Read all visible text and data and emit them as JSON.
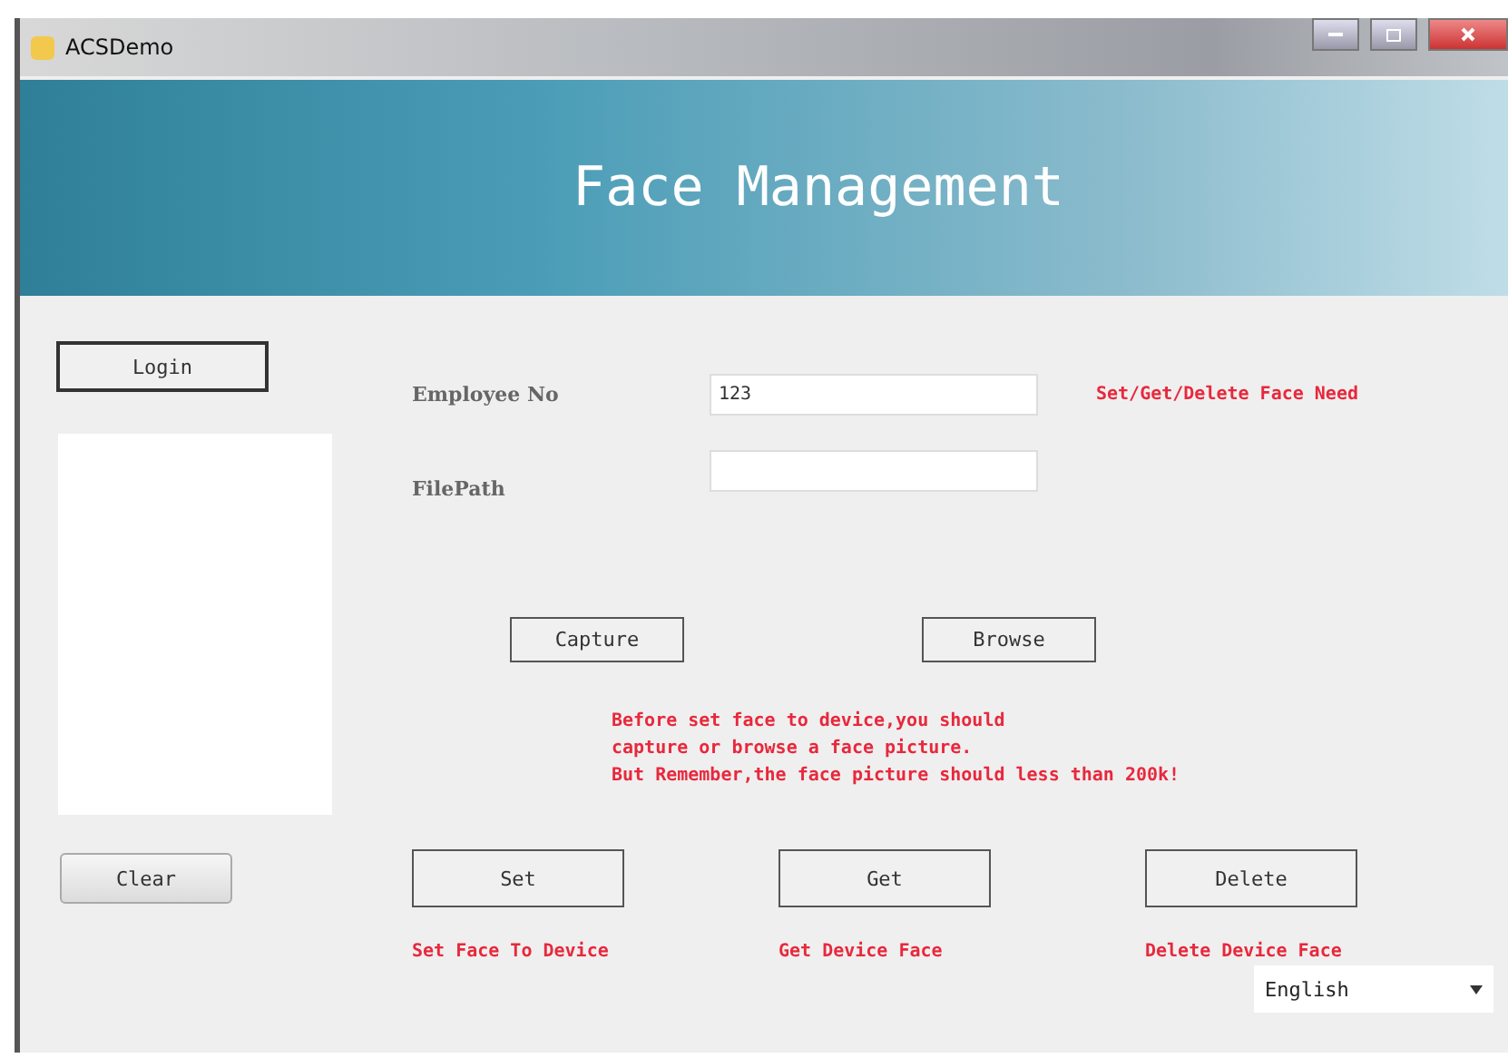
{
  "window": {
    "title": "ACSDemo"
  },
  "header": {
    "title": "Face Management"
  },
  "sidebar": {
    "login_button": "Login",
    "clear_button": "Clear"
  },
  "form": {
    "fields": [
      {
        "label": "Employee No",
        "value": "123"
      },
      {
        "label": "FilePath"
      }
    ],
    "hint": "Set/Get/Delete Face Need"
  },
  "picture_buttons": [
    "Capture",
    "Browse"
  ],
  "note": [
    "Before set face to device,you should",
    "capture or browse a face picture.",
    "But Remember,the face picture should less than 200k!"
  ],
  "actions": [
    {
      "label": "Set",
      "caption": "Set Face To Device"
    },
    {
      "label": "Get",
      "caption": "Get Device Face"
    },
    {
      "label": "Delete",
      "caption": "Delete Device Face"
    }
  ],
  "language": {
    "value": "English"
  }
}
